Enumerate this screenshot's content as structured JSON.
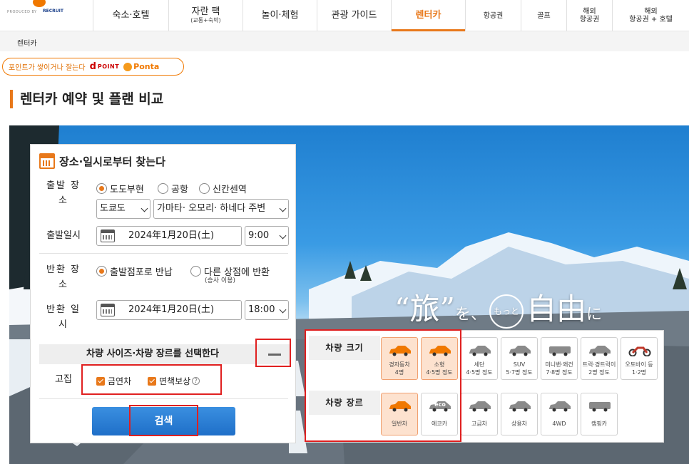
{
  "logo": {
    "produced_by": "PRODUCED BY",
    "brand": "RECRUIT"
  },
  "nav": {
    "items": [
      {
        "label": "숙소·호텔",
        "sub": ""
      },
      {
        "label": "자란 팩",
        "sub": "(교통+숙박)"
      },
      {
        "label": "놀이·체험",
        "sub": ""
      },
      {
        "label": "관광 가이드",
        "sub": ""
      },
      {
        "label": "렌터카",
        "sub": ""
      },
      {
        "label": "항공권",
        "sub": ""
      },
      {
        "label": "골프",
        "sub": ""
      },
      {
        "label": "해외",
        "sub": "항공권"
      },
      {
        "label": "해외",
        "sub": "항공권 + 호텔"
      }
    ]
  },
  "breadcrumb": {
    "current": "렌터카"
  },
  "points": {
    "text": "포인트가 쌓이거나 잘는다",
    "dpoint": "POINT",
    "ponta": "Ponta"
  },
  "page_title": "렌터카 예약 및 플랜 비교",
  "slogan": {
    "a": "“旅”",
    "b": "を、",
    "circle": "もっと",
    "c": "自由",
    "d": "に"
  },
  "search": {
    "header": "장소·일시로부터 찾는다",
    "departure_place_label": "출발 장소",
    "departure_place_options": [
      "도도부현",
      "공항",
      "신칸센역"
    ],
    "prefecture": "도쿄도",
    "area": "가마타· 오모리· 하네다 주변",
    "departure_datetime_label": "출발일시",
    "departure_date": "2024年1月20日(土)",
    "departure_time": "9:00",
    "return_place_label": "반환 장소",
    "return_place_options": [
      "출발점포로 반납",
      "다른 상점에 반환"
    ],
    "return_place_note": "(승사 이용)",
    "return_datetime_label": "반환 일시",
    "return_date": "2024年1月20日(土)",
    "return_time": "18:00",
    "vehicle_select_label": "차량 사이즈·차량 장르를 선택한다",
    "particular_label": "고집",
    "checkboxes": [
      "금연차",
      "면책보상"
    ],
    "search_button": "검색"
  },
  "vehicle": {
    "size_label": "차량 크기",
    "sizes": [
      {
        "name": "경자동차",
        "cap": "4명",
        "selected": true
      },
      {
        "name": "소형",
        "cap": "4·5명 정도",
        "selected": true
      },
      {
        "name": "세단",
        "cap": "4·5명 정도",
        "selected": false
      },
      {
        "name": "SUV",
        "cap": "5·7명 정도",
        "selected": false
      },
      {
        "name": "미니밴·왜건",
        "cap": "7·8명 정도",
        "selected": false
      },
      {
        "name": "트럭·경트럭이",
        "cap": "2명 정도",
        "selected": false
      },
      {
        "name": "오토바이 등",
        "cap": "1·2명",
        "selected": false
      }
    ],
    "genre_label": "차량 장르",
    "genres": [
      {
        "name": "일반차",
        "selected": true
      },
      {
        "name": "에코카",
        "selected": false
      },
      {
        "name": "고급차",
        "selected": false
      },
      {
        "name": "상용차",
        "selected": false
      },
      {
        "name": "4WD",
        "selected": false
      },
      {
        "name": "캠핑카",
        "selected": false
      }
    ],
    "eco_badge": "eco"
  },
  "colors": {
    "accent": "#e8781a",
    "button": "#2a80d8",
    "highlight": "#e02020"
  }
}
